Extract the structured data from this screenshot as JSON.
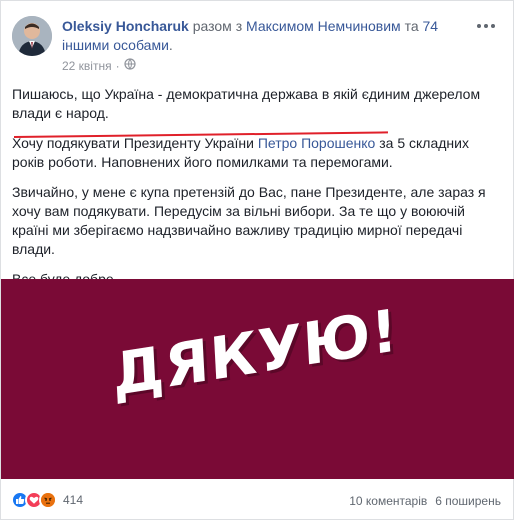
{
  "post": {
    "author_name": "Oleksiy Honcharuk",
    "with_prefix": " разом з ",
    "with_person": "Максимом Немчиновим",
    "with_and": " та ",
    "with_others": "74 іншими особами",
    "with_suffix": ".",
    "date": "22 квітня",
    "paragraph_1": "Пишаюсь, що Україна - демократична держава в якій єдиним джерелом влади є народ.",
    "paragraph_2_before": "Хочу подякувати Президенту України ",
    "paragraph_2_mention": "Петро Порошенко",
    "paragraph_2_after": " за 5 складних років роботи. Наповнених його помилками та перемогами.",
    "paragraph_3": "Звичайно, у мене є купа претензій до Вас, пане Президенте, але зараз я хочу вам подякувати. Передусім за вільні вибори. За те що у воюючій країні ми зберігаємо надзвичайно важливу традицію мирної передачі влади.",
    "paragraph_4": "Все буде добре.",
    "banner_text": "ДЯКУЮ!",
    "banner_color": "#7a0a36"
  },
  "footer": {
    "reaction_count": "414",
    "comments": "10 коментарів",
    "shares": "6 поширень"
  },
  "icons": {
    "reactions": [
      "like-icon",
      "love-icon",
      "angry-icon"
    ],
    "privacy": "globe-icon",
    "menu": "more-options-icon"
  },
  "colors": {
    "link": "#385898",
    "annotation_underline": "#e0202a"
  }
}
